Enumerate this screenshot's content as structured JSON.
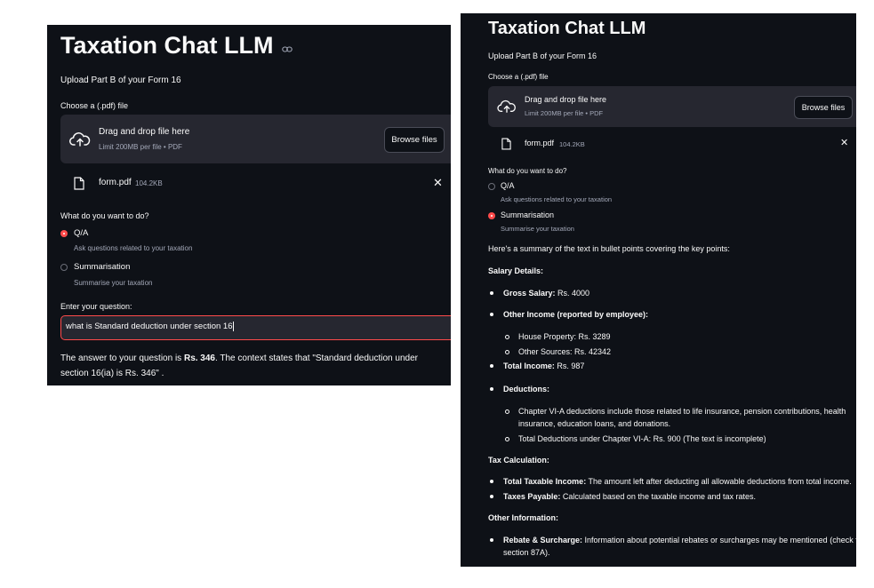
{
  "left": {
    "title": "Taxation Chat LLM",
    "subtitle": "Upload Part B of your Form 16",
    "file_label": "Choose a (.pdf) file",
    "uploader": {
      "title": "Drag and drop file here",
      "limit": "Limit 200MB per file • PDF",
      "browse": "Browse files"
    },
    "file": {
      "name": "form.pdf",
      "size": "104.2KB"
    },
    "question_label": "What do you want to do?",
    "options": [
      {
        "label": "Q/A",
        "caption": "Ask questions related to your taxation",
        "selected": true
      },
      {
        "label": "Summarisation",
        "caption": "Summarise your taxation",
        "selected": false
      }
    ],
    "input_label": "Enter your question:",
    "input_value": "what is Standard deduction under section 16",
    "answer": {
      "pre": "The answer to your question is ",
      "bold": "Rs. 346",
      "post": ". The context states that \"Standard deduction under section 16(ia) is Rs. 346\" ."
    }
  },
  "right": {
    "title": "Taxation Chat LLM",
    "subtitle": "Upload Part B of your Form 16",
    "file_label": "Choose a (.pdf) file",
    "uploader": {
      "title": "Drag and drop file here",
      "limit": "Limit 200MB per file • PDF",
      "browse": "Browse files"
    },
    "file": {
      "name": "form.pdf",
      "size": "104.2KB"
    },
    "question_label": "What do you want to do?",
    "options": [
      {
        "label": "Q/A",
        "caption": "Ask questions related to your taxation",
        "selected": false
      },
      {
        "label": "Summarisation",
        "caption": "Summarise your taxation",
        "selected": true
      }
    ],
    "summary": {
      "intro": "Here's a summary of the text in bullet points covering the key points:",
      "salary_heading": "Salary Details:",
      "gross_salary": {
        "label": "Gross Salary:",
        "text": " Rs. 4000"
      },
      "other_income": {
        "label": "Other Income (reported by employee):"
      },
      "house_property": "House Property: Rs. 3289",
      "other_sources": "Other Sources: Rs. 42342",
      "total_income": {
        "label": "Total Income:",
        "text": " Rs. 987"
      },
      "deductions": {
        "label": "Deductions:"
      },
      "chapter_via": "Chapter VI-A deductions include those related to life insurance, pension contributions, health insurance, education loans, and donations.",
      "total_deductions": "Total Deductions under Chapter VI-A: Rs. 900 (The text is incomplete)",
      "tax_heading": "Tax Calculation:",
      "taxable_income": {
        "label": "Total Taxable Income:",
        "text": " The amount left after deducting all allowable deductions from total income."
      },
      "taxes_payable": {
        "label": "Taxes Payable:",
        "text": " Calculated based on the taxable income and tax rates."
      },
      "other_heading": "Other Information:",
      "rebate": {
        "label": "Rebate & Surcharge:",
        "text": " Information about potential rebates or surcharges may be mentioned (check for section 87A)."
      }
    }
  }
}
